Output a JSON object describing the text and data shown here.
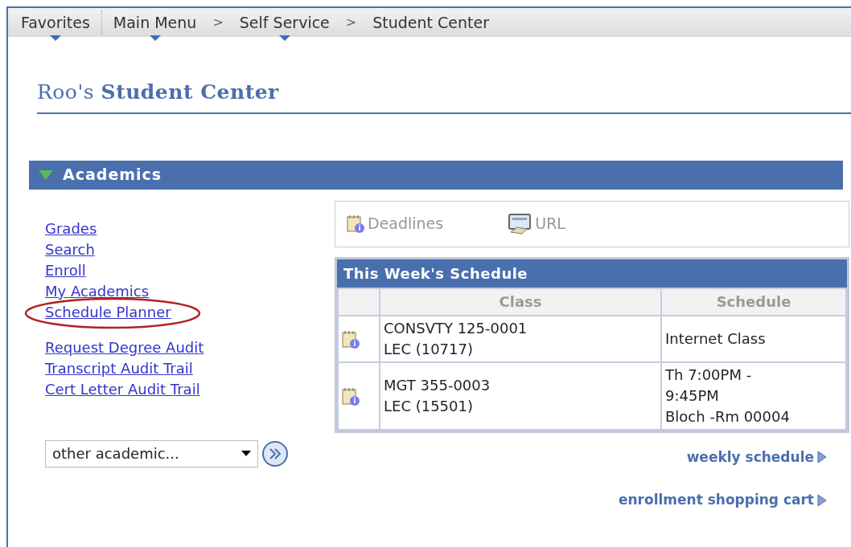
{
  "breadcrumb": [
    {
      "label": "Favorites",
      "dropdown": true
    },
    {
      "label": "Main Menu",
      "dropdown": true
    },
    {
      "label": "Self Service",
      "dropdown": true
    },
    {
      "label": "Student Center",
      "dropdown": false
    }
  ],
  "breadcrumb_separator": ">",
  "page_title": "Roo's **Student Center**",
  "section": {
    "title": "Academics",
    "expanded": true
  },
  "links": [
    {
      "label": "Grades",
      "highlighted": false
    },
    {
      "label": "Search",
      "highlighted": false
    },
    {
      "label": "Enroll",
      "highlighted": false
    },
    {
      "label": "My Academics",
      "highlighted": false
    },
    {
      "label": "Schedule Planner",
      "highlighted": true
    },
    {
      "label": "Request Degree Audit",
      "highlighted": false
    },
    {
      "label": "Transcript Audit Trail",
      "highlighted": false
    },
    {
      "label": "Cert Letter Audit Trail",
      "highlighted": false
    }
  ],
  "dropdown": {
    "value": "other academic..."
  },
  "toolbar": [
    {
      "label": "Deadlines",
      "kind": "calendar"
    },
    {
      "label": "URL",
      "kind": "monitor"
    }
  ],
  "schedule": {
    "title": "This Week's Schedule",
    "columns": [
      "Class",
      "Schedule"
    ],
    "rows": [
      {
        "class": [
          "CONSVTY 125-0001",
          "LEC (10717)"
        ],
        "schedule": [
          "Internet Class"
        ]
      },
      {
        "class": [
          "MGT 355-0003",
          "LEC (15501)"
        ],
        "schedule": [
          "Th 7:00PM -",
          "9:45PM",
          "Bloch -Rm 00004"
        ]
      }
    ]
  },
  "footer_links": [
    "weekly schedule",
    "enrollment shopping cart"
  ]
}
